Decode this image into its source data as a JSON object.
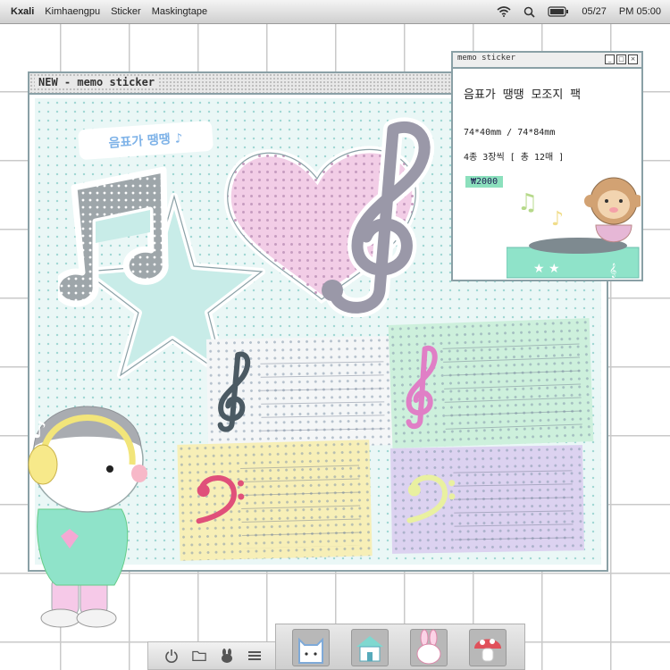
{
  "menubar": {
    "app": "Kxali",
    "items": [
      "Kimhaengpu",
      "Sticker",
      "Maskingtape"
    ],
    "date": "05/27",
    "time": "PM 05:00"
  },
  "main_window": {
    "title": "NEW - memo sticker"
  },
  "info_window": {
    "title": "memo sticker",
    "product_name": "음표가 땡땡 모조지 팩",
    "sizes": "74*40mm / 74*84mm",
    "count": "4종 3장씩 [ 총 12매 ]",
    "price": "₩2000"
  },
  "sticker_header": "음표가 땡땡 ♪",
  "colors": {
    "mint": "#c8ece8",
    "pink": "#f2cde6",
    "gray": "#9ea6aa",
    "yellow": "#f7efb7",
    "lavender": "#dcd2f0",
    "green": "#cdf0dc",
    "price_bg": "#8ce0bd"
  },
  "dock": {
    "left_icons": [
      "power-icon",
      "folder-icon",
      "rabbit-icon",
      "menu-icon"
    ],
    "apps": [
      "cat-app-icon",
      "house-app-icon",
      "bunny-app-icon",
      "mushroom-app-icon"
    ]
  }
}
